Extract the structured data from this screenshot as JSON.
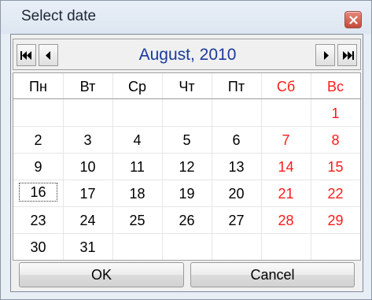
{
  "window": {
    "title": "Select date"
  },
  "navigation": {
    "month_label": "August, 2010",
    "prev_year_icon": "double-left-arrow",
    "prev_month_icon": "left-arrow",
    "next_month_icon": "right-arrow",
    "next_year_icon": "double-right-arrow"
  },
  "calendar": {
    "weekdays": [
      "Пн",
      "Вт",
      "Ср",
      "Чт",
      "Пт",
      "Сб",
      "Вс"
    ],
    "weeks": [
      [
        "",
        "",
        "",
        "",
        "",
        "",
        "1"
      ],
      [
        "2",
        "3",
        "4",
        "5",
        "6",
        "7",
        "8"
      ],
      [
        "9",
        "10",
        "11",
        "12",
        "13",
        "14",
        "15"
      ],
      [
        "16",
        "17",
        "18",
        "19",
        "20",
        "21",
        "22"
      ],
      [
        "23",
        "24",
        "25",
        "26",
        "27",
        "28",
        "29"
      ],
      [
        "30",
        "31",
        "",
        "",
        "",
        "",
        ""
      ]
    ],
    "selected_day": "16",
    "weekend_color": "#ff1a1a",
    "header_color": "#1a3a9c"
  },
  "buttons": {
    "ok_label": "OK",
    "cancel_label": "Cancel"
  }
}
